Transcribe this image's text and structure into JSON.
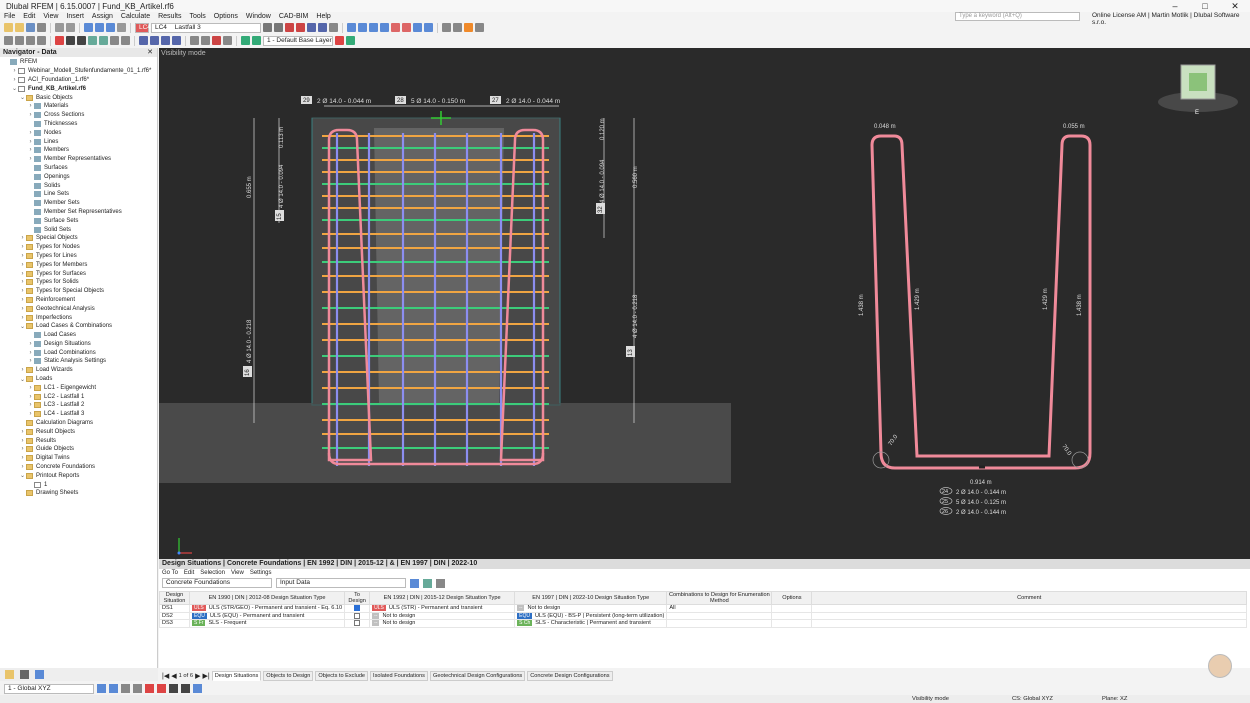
{
  "window": {
    "title": "Dlubal RFEM | 6.15.0007 | Fund_KB_Artikel.rf6",
    "minimize": "–",
    "maximize": "□",
    "close": "✕"
  },
  "menu": [
    "File",
    "Edit",
    "View",
    "Insert",
    "Assign",
    "Calculate",
    "Results",
    "Tools",
    "Options",
    "Window",
    "CAD-BIM",
    "Help"
  ],
  "search_placeholder": "Type a keyword (Alt+Q)",
  "license": "Online License AM | Martin Motlik | Dlubal Software s.r.o.",
  "toolbar": {
    "lc_badge": "LC4",
    "lc_code": "LC4",
    "lc_name": "Lastfall 3",
    "layer": "1 - Default Base Layer"
  },
  "navigator": {
    "title": "Navigator - Data",
    "items": [
      {
        "label": "RFEM",
        "depth": 0,
        "toggle": "",
        "icon": "item",
        "bold": false
      },
      {
        "label": "Webinar_Modell_Stufenfundamente_01_1.rf6*",
        "depth": 1,
        "toggle": "›",
        "icon": "file",
        "bold": false
      },
      {
        "label": "ACI_Foundation_1.rf6*",
        "depth": 1,
        "toggle": "›",
        "icon": "file",
        "bold": false
      },
      {
        "label": "Fund_KB_Artikel.rf6",
        "depth": 1,
        "toggle": "⌄",
        "icon": "file",
        "bold": true
      },
      {
        "label": "Basic Objects",
        "depth": 2,
        "toggle": "⌄",
        "icon": "fold",
        "bold": false
      },
      {
        "label": "Materials",
        "depth": 3,
        "toggle": "›",
        "icon": "item",
        "bold": false
      },
      {
        "label": "Cross Sections",
        "depth": 3,
        "toggle": "›",
        "icon": "item",
        "bold": false
      },
      {
        "label": "Thicknesses",
        "depth": 3,
        "toggle": "",
        "icon": "item",
        "bold": false
      },
      {
        "label": "Nodes",
        "depth": 3,
        "toggle": "›",
        "icon": "item",
        "bold": false
      },
      {
        "label": "Lines",
        "depth": 3,
        "toggle": "›",
        "icon": "item",
        "bold": false
      },
      {
        "label": "Members",
        "depth": 3,
        "toggle": "›",
        "icon": "item",
        "bold": false
      },
      {
        "label": "Member Representatives",
        "depth": 3,
        "toggle": "›",
        "icon": "item",
        "bold": false
      },
      {
        "label": "Surfaces",
        "depth": 3,
        "toggle": "",
        "icon": "item",
        "bold": false
      },
      {
        "label": "Openings",
        "depth": 3,
        "toggle": "",
        "icon": "item",
        "bold": false
      },
      {
        "label": "Solids",
        "depth": 3,
        "toggle": "",
        "icon": "item",
        "bold": false
      },
      {
        "label": "Line Sets",
        "depth": 3,
        "toggle": "",
        "icon": "item",
        "bold": false
      },
      {
        "label": "Member Sets",
        "depth": 3,
        "toggle": "",
        "icon": "item",
        "bold": false
      },
      {
        "label": "Member Set Representatives",
        "depth": 3,
        "toggle": "",
        "icon": "item",
        "bold": false
      },
      {
        "label": "Surface Sets",
        "depth": 3,
        "toggle": "",
        "icon": "item",
        "bold": false
      },
      {
        "label": "Solid Sets",
        "depth": 3,
        "toggle": "",
        "icon": "item",
        "bold": false
      },
      {
        "label": "Special Objects",
        "depth": 2,
        "toggle": "›",
        "icon": "fold",
        "bold": false
      },
      {
        "label": "Types for Nodes",
        "depth": 2,
        "toggle": "›",
        "icon": "fold",
        "bold": false
      },
      {
        "label": "Types for Lines",
        "depth": 2,
        "toggle": "›",
        "icon": "fold",
        "bold": false
      },
      {
        "label": "Types for Members",
        "depth": 2,
        "toggle": "›",
        "icon": "fold",
        "bold": false
      },
      {
        "label": "Types for Surfaces",
        "depth": 2,
        "toggle": "›",
        "icon": "fold",
        "bold": false
      },
      {
        "label": "Types for Solids",
        "depth": 2,
        "toggle": "›",
        "icon": "fold",
        "bold": false
      },
      {
        "label": "Types for Special Objects",
        "depth": 2,
        "toggle": "›",
        "icon": "fold",
        "bold": false
      },
      {
        "label": "Reinforcement",
        "depth": 2,
        "toggle": "›",
        "icon": "fold",
        "bold": false
      },
      {
        "label": "Geotechnical Analysis",
        "depth": 2,
        "toggle": "›",
        "icon": "fold",
        "bold": false
      },
      {
        "label": "Imperfections",
        "depth": 2,
        "toggle": "›",
        "icon": "fold",
        "bold": false
      },
      {
        "label": "Load Cases & Combinations",
        "depth": 2,
        "toggle": "⌄",
        "icon": "fold",
        "bold": false
      },
      {
        "label": "Load Cases",
        "depth": 3,
        "toggle": "",
        "icon": "item",
        "bold": false
      },
      {
        "label": "Design Situations",
        "depth": 3,
        "toggle": "›",
        "icon": "item",
        "bold": false
      },
      {
        "label": "Load Combinations",
        "depth": 3,
        "toggle": "›",
        "icon": "item",
        "bold": false
      },
      {
        "label": "Static Analysis Settings",
        "depth": 3,
        "toggle": "›",
        "icon": "item",
        "bold": false
      },
      {
        "label": "Load Wizards",
        "depth": 2,
        "toggle": "›",
        "icon": "fold",
        "bold": false
      },
      {
        "label": "Loads",
        "depth": 2,
        "toggle": "⌄",
        "icon": "fold",
        "bold": false
      },
      {
        "label": "LC1 - Eigengewicht",
        "depth": 3,
        "toggle": "›",
        "icon": "fold",
        "bold": false
      },
      {
        "label": "LC2 - Lastfall 1",
        "depth": 3,
        "toggle": "›",
        "icon": "fold",
        "bold": false
      },
      {
        "label": "LC3 - Lastfall 2",
        "depth": 3,
        "toggle": "›",
        "icon": "fold",
        "bold": false
      },
      {
        "label": "LC4 - Lastfall 3",
        "depth": 3,
        "toggle": "›",
        "icon": "fold",
        "bold": false
      },
      {
        "label": "Calculation Diagrams",
        "depth": 2,
        "toggle": "",
        "icon": "fold",
        "bold": false
      },
      {
        "label": "Result Objects",
        "depth": 2,
        "toggle": "›",
        "icon": "fold",
        "bold": false
      },
      {
        "label": "Results",
        "depth": 2,
        "toggle": "›",
        "icon": "fold",
        "bold": false
      },
      {
        "label": "Guide Objects",
        "depth": 2,
        "toggle": "›",
        "icon": "fold",
        "bold": false
      },
      {
        "label": "Digital Twins",
        "depth": 2,
        "toggle": "›",
        "icon": "fold",
        "bold": false
      },
      {
        "label": "Concrete Foundations",
        "depth": 2,
        "toggle": "›",
        "icon": "fold",
        "bold": false
      },
      {
        "label": "Printout Reports",
        "depth": 2,
        "toggle": "⌄",
        "icon": "fold",
        "bold": false
      },
      {
        "label": "1",
        "depth": 3,
        "toggle": "",
        "icon": "file",
        "bold": false
      },
      {
        "label": "Drawing Sheets",
        "depth": 2,
        "toggle": "",
        "icon": "fold",
        "bold": false
      }
    ]
  },
  "viewport": {
    "mode_label": "Visibility mode",
    "left_dims": {
      "top_labels": [
        {
          "num": "29",
          "text": "2 Ø 14.0 - 0.044 m"
        },
        {
          "num": "28",
          "text": "5 Ø 14.0 - 0.150 m"
        },
        {
          "num": "27",
          "text": "2 Ø 14.0 - 0.044 m"
        }
      ],
      "left_vertical": [
        "0.655 m",
        "0.113 m",
        "4 Ø 14.0 - 0.094",
        "4 Ø 14.0 - 0.218"
      ],
      "left_badges": [
        "15",
        "16"
      ],
      "right_vertical": [
        "0.120 m",
        "4 Ø 14.0 - 0.094",
        "0.560 m",
        "4 Ø 14.0 - 0.218"
      ],
      "right_badges": [
        "32",
        "13"
      ]
    },
    "right_dims": {
      "top_left": "0.048 m",
      "top_right": "0.055 m",
      "outer_left": "1.438 m",
      "inner_left": "1.429 m",
      "inner_right": "1.429 m",
      "outer_right": "1.438 m",
      "bend_left": "70.0",
      "bend_right": "70.0",
      "bottom": "0.914 m",
      "bars": [
        {
          "num": "24",
          "text": "2 Ø 14.0 - 0.144 m"
        },
        {
          "num": "25",
          "text": "5 Ø 14.0 - 0.125 m"
        },
        {
          "num": "26",
          "text": "2 Ø 14.0 - 0.144 m"
        }
      ]
    },
    "navcube_label": "E"
  },
  "bottom_panel": {
    "title": "Design Situations | Concrete Foundations | EN 1992 | DIN | 2015-12 | & | EN 1997 | DIN | 2022-10",
    "menu": [
      "Go To",
      "Edit",
      "Selection",
      "View",
      "Settings"
    ],
    "module_select": "Concrete Foundations",
    "data_select": "Input Data",
    "headers": [
      "Design Situation",
      "EN 1990 | DIN | 2012-08 Design Situation Type",
      "To Design",
      "EN 1992 | DIN | 2015-12 Design Situation Type",
      "EN 1997 | DIN | 2022-10 Design Situation Type",
      "Combinations to Design for Enumeration Method",
      "Options",
      "Comment"
    ],
    "rows": [
      {
        "id": "DS1",
        "b1": "ULS",
        "b1color": "#e05a5a",
        "t1": "ULS (STR/GEO) - Permanent and transient - Eq. 6.10",
        "design": true,
        "b2": "ULS",
        "b2color": "#e05a5a",
        "t2": "ULS (STR) - Permanent and transient",
        "b3": "--",
        "b3color": "#c0c0c0",
        "t3": "Not to design",
        "comb": "All"
      },
      {
        "id": "DS2",
        "b1": "EQU",
        "b1color": "#2d6fc4",
        "t1": "ULS (EQU) - Permanent and transient",
        "design": false,
        "b2": "--",
        "b2color": "#c0c0c0",
        "t2": "Not to design",
        "b3": "EQU",
        "b3color": "#2d6fc4",
        "t3": "ULS (EQU) - BS-P | Persistent (long-term utilization)",
        "comb": ""
      },
      {
        "id": "DS3",
        "b1": "S Fr",
        "b1color": "#6bb35a",
        "t1": "SLS - Frequent",
        "design": false,
        "b2": "--",
        "b2color": "#c0c0c0",
        "t2": "Not to design",
        "b3": "S Ch",
        "b3color": "#6bb35a",
        "t3": "SLS - Characteristic | Permanent and transient",
        "comb": ""
      }
    ],
    "pager": "1 of 6",
    "tabs": [
      "Design Situations",
      "Objects to Design",
      "Objects to Exclude",
      "Isolated Foundations",
      "Geotechnical Design Configurations",
      "Concrete Design Configurations"
    ]
  },
  "bottom_toolbar": {
    "cs_select": "1 - Global XYZ"
  },
  "status": {
    "visibility": "Visibility mode",
    "cs": "CS: Global XYZ",
    "plane": "Plane: XZ"
  },
  "colors": {
    "rebar_pink": "#f08a9a",
    "rebar_blue": "#8c8ef0",
    "rebar_orange": "#f0a542",
    "rebar_green": "#3ccc7a",
    "viewport_bg": "#2a2a2a",
    "concrete": "#4a4a4a"
  }
}
